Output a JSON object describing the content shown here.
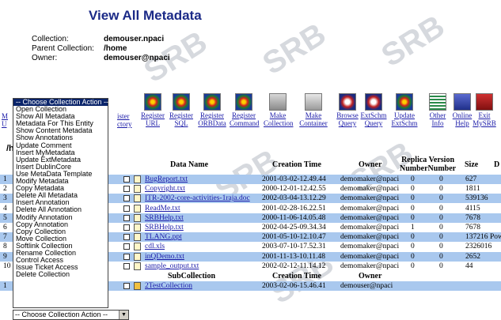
{
  "page": {
    "title": "View All Metadata",
    "collection_label": "Collection:",
    "collection_value": "demouser.npaci",
    "parent_label": "Parent Collection:",
    "parent_value": "/home",
    "owner_label": "Owner:",
    "owner_value": "demouser@npaci",
    "path_prefix": "/h",
    "watermark_text": "SRB"
  },
  "toolbar": [
    {
      "label": "Register\nURL",
      "icon": "spiral-icon"
    },
    {
      "label": "Register\nSQL",
      "icon": "spiral-icon"
    },
    {
      "label": "Register\nORBData",
      "icon": "spiral-icon"
    },
    {
      "label": "Register\nCommand",
      "icon": "spiral-icon"
    },
    {
      "label": "Make\nCollection",
      "icon": "folder-make-icon"
    },
    {
      "label": "Make\nContainer",
      "icon": "container-make-icon"
    },
    {
      "label": "Browse\nQuery",
      "icon": "browse-query-icon"
    },
    {
      "label": "ExtSchm\nQuery",
      "icon": "ext-query-icon"
    },
    {
      "label": "Update\nExtSchm",
      "icon": "spiral-icon"
    },
    {
      "label": "Other\nInfo",
      "icon": "info-icon"
    },
    {
      "label": "Online\nHelp",
      "icon": "help-icon"
    },
    {
      "label": "Exit\nMySRB",
      "icon": "exit-icon"
    }
  ],
  "toolbar_left_partial": [
    "ister",
    "ctory"
  ],
  "toolbar_left_partial2": [
    "M",
    "U"
  ],
  "table": {
    "headers": {
      "name": "Data Name",
      "time": "Creation Time",
      "owner": "Owner",
      "replica": "Replica Version\nNumberNumber",
      "size": "Size",
      "extra": "D"
    },
    "rows": [
      {
        "num": "1",
        "name": "BugReport.txt",
        "time": "2001-03-02-12.49.44",
        "owner": "demomaker@npaci",
        "replica": "0",
        "version": "0",
        "size": "627",
        "extra": ""
      },
      {
        "num": "2",
        "name": "Copyright.txt",
        "time": "2000-12-01-12.42.55",
        "owner": "demomaker@npaci",
        "replica": "0",
        "version": "0",
        "size": "1811",
        "extra": ""
      },
      {
        "num": "3",
        "name": "ITR-2002-core-activities-1raja.doc",
        "time": "2002-03-04-13.12.29",
        "owner": "demomaker@npaci",
        "replica": "0",
        "version": "0",
        "size": "539136",
        "extra": ""
      },
      {
        "num": "4",
        "name": "ReadMe.txt",
        "time": "2001-02-28-16.22.51",
        "owner": "demomaker@npaci",
        "replica": "0",
        "version": "0",
        "size": "4115",
        "extra": ""
      },
      {
        "num": "5",
        "name": "SRBHelp.txt",
        "time": "2000-11-06-14.05.48",
        "owner": "demomaker@npaci",
        "replica": "0",
        "version": "0",
        "size": "7678",
        "extra": ""
      },
      {
        "num": "6",
        "name": "SRBHelp.txt",
        "time": "2002-04-25-09.34.34",
        "owner": "demomaker@npaci",
        "replica": "1",
        "version": "0",
        "size": "7678",
        "extra": ""
      },
      {
        "num": "7",
        "name": "TLANG.ppt",
        "time": "2001-05-10-12.10.47",
        "owner": "demomaker@npaci",
        "replica": "0",
        "version": "0",
        "size": "137216",
        "extra": "Pow"
      },
      {
        "num": "8",
        "name": "cdl.xls",
        "time": "2003-07-10-17.52.31",
        "owner": "demomaker@npaci",
        "replica": "0",
        "version": "0",
        "size": "2326016",
        "extra": ""
      },
      {
        "num": "9",
        "name": "inQDemo.txt",
        "time": "2001-11-13-10.11.48",
        "owner": "demomaker@npaci",
        "replica": "0",
        "version": "0",
        "size": "2652",
        "extra": ""
      },
      {
        "num": "10",
        "name": "sample_output.txt",
        "time": "2002-02-12-11.14.12",
        "owner": "demomaker@npaci",
        "replica": "0",
        "version": "0",
        "size": "44",
        "extra": ""
      }
    ],
    "sub_headers": {
      "name": "SubCollection",
      "time": "Creation Time",
      "owner": "Owner"
    },
    "sub_rows": [
      {
        "num": "1",
        "name": "2TestCollection",
        "time": "2003-02-06-15.46.41",
        "owner": "demouser@npaci"
      }
    ]
  },
  "dropdown": {
    "options": [
      "-- Choose Collection Action --",
      "Open Collection",
      "Show All Metadata",
      "Metadata For This Entity",
      "Show Content Metadata",
      "Show Annotations",
      "Update Comment",
      "Insert MyMetadata",
      "Update ExtMetadata",
      "Insert DublinCore",
      "Use MetaData Template",
      "Modify Metadata",
      "Copy Metadata",
      "Delete All Metadata",
      "Insert Annotation",
      "Delete All Annotation",
      "Modify Annotation",
      "Copy Annotation",
      "Copy Collection",
      "Move Collection",
      "Softlink Collection",
      "Rename Collection",
      "Control Access",
      "Issue Ticket Access",
      "Delete Collection"
    ],
    "selected_value": "-- Choose Collection Action --"
  },
  "colors": {
    "title": "#1b2a87",
    "row_band": "#a9c8ee",
    "link": "#1a1aa8",
    "selected": "#0a246a"
  }
}
